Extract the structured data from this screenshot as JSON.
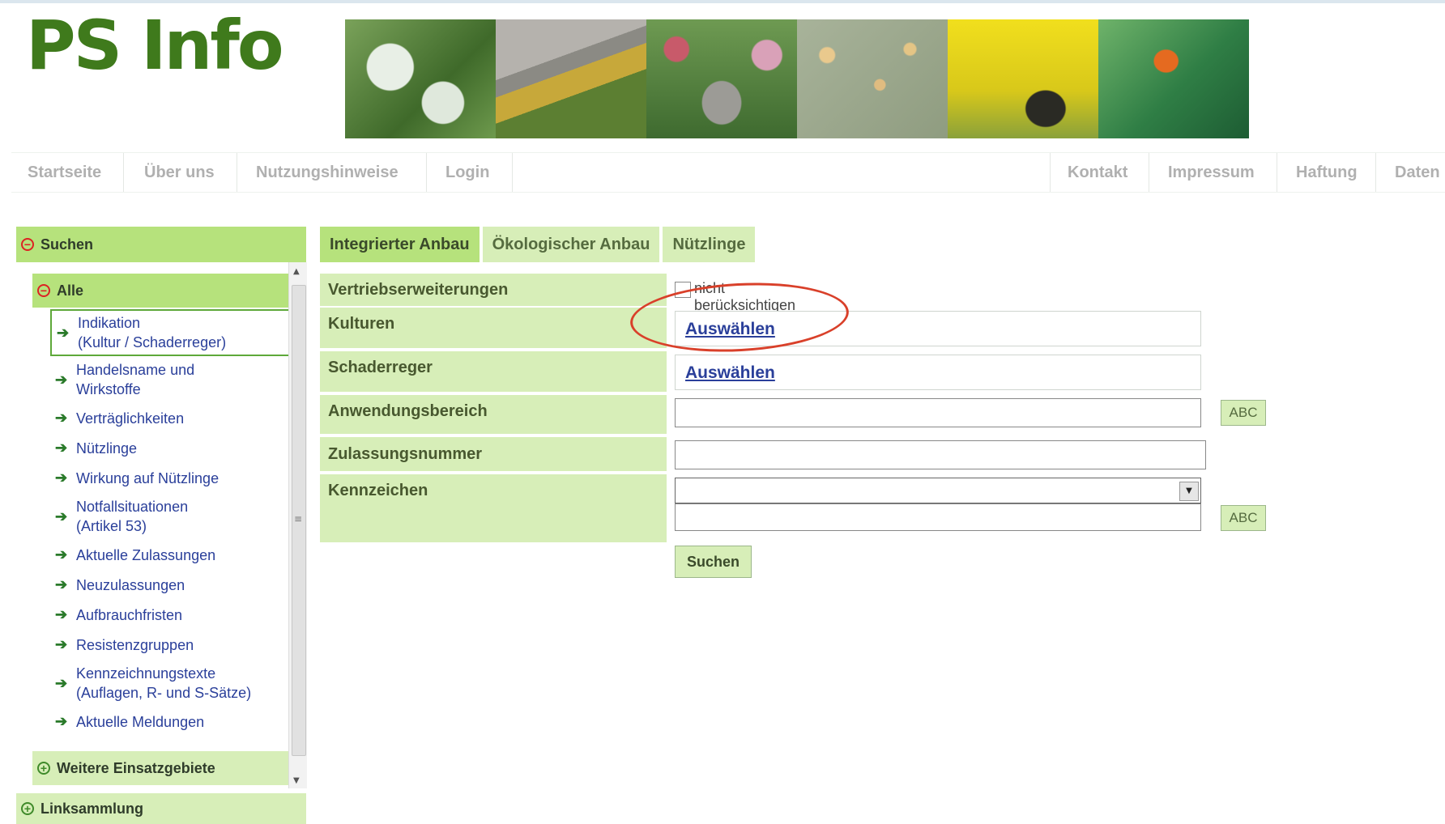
{
  "brand": {
    "logo_text": "PS Info"
  },
  "banner_images": [
    "plant-leaf-photo",
    "garden-path-photo",
    "garden-photo",
    "leaf-pests-photo",
    "flower-beetle-photo",
    "wasp-on-leaf-photo"
  ],
  "topnav": {
    "left": [
      "Startseite",
      "Über uns",
      "Nutzungshinweise",
      "Login"
    ],
    "right": [
      "Kontakt",
      "Impressum",
      "Haftung",
      "Daten"
    ]
  },
  "sidebar": {
    "search_label": "Suchen",
    "all_label": "Alle",
    "items": [
      {
        "label": "Indikation\n(Kultur / Schaderreger)",
        "selected": true
      },
      {
        "label": "Handelsname und\nWirkstoffe"
      },
      {
        "label": "Verträglichkeiten"
      },
      {
        "label": "Nützlinge"
      },
      {
        "label": "Wirkung auf Nützlinge"
      },
      {
        "label": "Notfallsituationen\n(Artikel 53)"
      },
      {
        "label": "Aktuelle Zulassungen"
      },
      {
        "label": "Neuzulassungen"
      },
      {
        "label": "Aufbrauchfristen"
      },
      {
        "label": "Resistenzgruppen"
      },
      {
        "label": "Kennzeichnungstexte\n(Auflagen, R- und S-Sätze)"
      },
      {
        "label": "Aktuelle Meldungen"
      }
    ],
    "more_label": "Weitere Einsatzgebiete",
    "links_label": "Linksammlung"
  },
  "tabs": [
    "Integrierter Anbau",
    "Ökologischer Anbau",
    "Nützlinge"
  ],
  "form": {
    "vertrieb_label": "Vertriebserweiterungen",
    "vertrieb_checkbox_label": "nicht berücksichtigen",
    "kulturen_label": "Kulturen",
    "kulturen_link": "Auswählen",
    "schaderreger_label": "Schaderreger",
    "schaderreger_link": "Auswählen",
    "anwendungsbereich_label": "Anwendungsbereich",
    "anwendungsbereich_value": "",
    "abc_label": "ABC",
    "zulassungsnummer_label": "Zulassungsnummer",
    "zulassungsnummer_value": "",
    "kennzeichen_label": "Kennzeichen",
    "kennzeichen_value": "",
    "kennzeichen_text_value": "",
    "search_button": "Suchen"
  },
  "colors": {
    "accent_green": "#b6e27c",
    "light_green": "#d7eeb8",
    "logo_green": "#3f7a1c",
    "link_blue": "#2a3f9a",
    "highlight_red": "#d9402a"
  }
}
